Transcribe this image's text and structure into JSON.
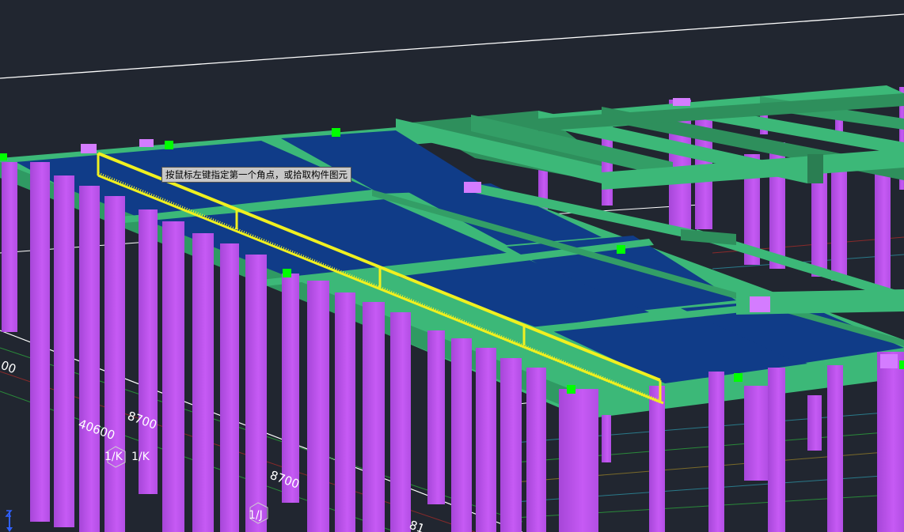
{
  "tooltip": {
    "text": "按鼠标左键指定第一个角点，或拾取构件图元"
  },
  "dimensions": {
    "d1": "8700",
    "d2": "40600",
    "d3": "8700",
    "d4": "00",
    "d5": "81"
  },
  "axis_labels": {
    "a1": "1/K",
    "a2": "1/K",
    "a3": "1/J"
  },
  "colors": {
    "background": "#212630",
    "column": "#c156f0",
    "beam": "#3fa771",
    "slab": "#0f3a84",
    "selection": "#f0f020",
    "grip": "#00ff00"
  },
  "ucs": {
    "icon": "ucs-axis-icon"
  }
}
